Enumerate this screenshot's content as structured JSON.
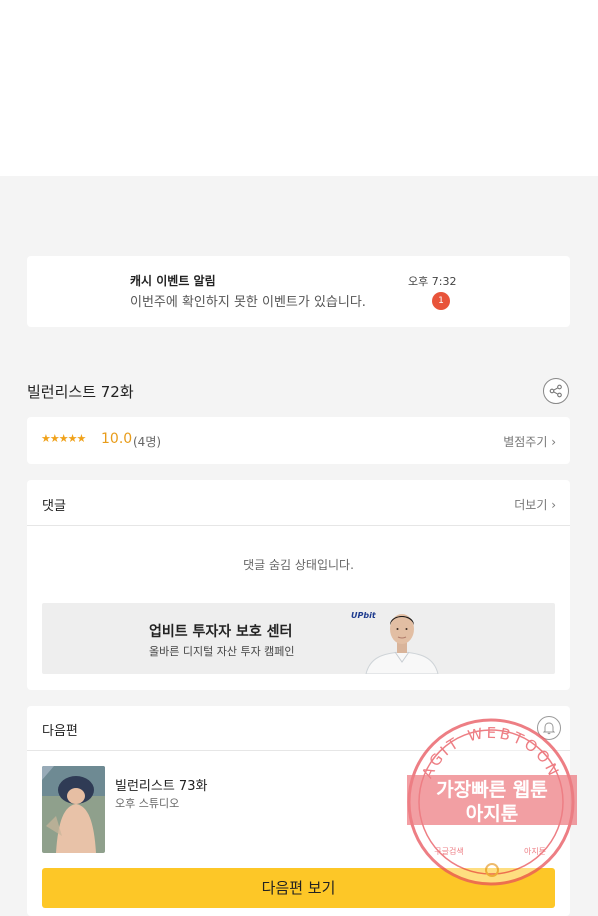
{
  "notification": {
    "title": "캐시 이벤트 알림",
    "message": "이번주에 확인하지 못한 이벤트가 있습니다.",
    "time": "오후 7:32",
    "badge_count": "1",
    "badge_color": "#e8543a"
  },
  "episode": {
    "title": "빌런리스트 72화",
    "share_icon": "share-icon"
  },
  "rating": {
    "stars": "★★★★★",
    "score": "10.0",
    "count": "(4명)",
    "rate_link": "별점주기 ›",
    "star_color": "#f0a21b"
  },
  "comments": {
    "label": "댓글",
    "more": "더보기 ›",
    "hidden_message": "댓글 숨김 상태입니다."
  },
  "ad": {
    "title": "업비트 투자자 보호 센터",
    "subtitle": "올바른 디지털 자산 투자 캠페인",
    "brand": "UPbit"
  },
  "next": {
    "label": "다음편",
    "bell_icon": "bell-icon",
    "episode_title": "빌런리스트 73화",
    "author": "오후 스튜디오",
    "button_label": "다음편 보기",
    "button_color": "#fdc727"
  },
  "watermark": {
    "arc_text": "AGIT WEBTOON",
    "line1": "가장빠른 웹툰",
    "line2": "아지툰",
    "bottom_left": "구글검색",
    "bottom_right": "아지툰",
    "color": "#e8545c"
  }
}
